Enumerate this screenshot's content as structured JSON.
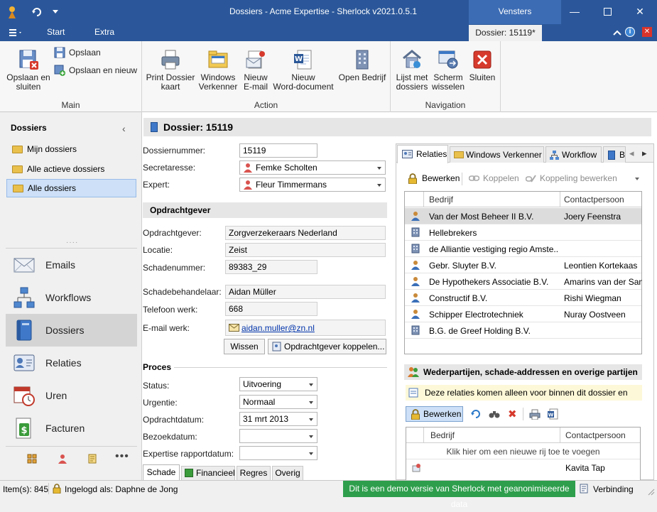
{
  "window": {
    "title": "Dossiers - Acme Expertise - Sherlock v2021.0.5.1",
    "vensters": "Vensters",
    "document_tab": "Dossier: 15119*",
    "menu_tabs": [
      "Start",
      "Extra"
    ]
  },
  "ribbon": {
    "groups": {
      "main": "Main",
      "action": "Action",
      "navigation": "Navigation"
    },
    "save_close": "Opslaan en\nsluiten",
    "save": "Opslaan",
    "save_new": "Opslaan en nieuw",
    "print": "Print Dossier\nkaart",
    "explorer": "Windows\nVerkenner",
    "new_email": "Nieuw\nE-mail",
    "new_word": "Nieuw\nWord-document",
    "open_company": "Open Bedrijf",
    "list_dossiers": "Lijst met\ndossiers",
    "switch_screen": "Scherm\nwisselen",
    "close": "Sluiten"
  },
  "left": {
    "header": "Dossiers",
    "folders": [
      "Mijn dossiers",
      "Alle actieve dossiers",
      "Alle dossiers"
    ],
    "nav": [
      "Emails",
      "Workflows",
      "Dossiers",
      "Relaties",
      "Uren",
      "Facturen"
    ]
  },
  "dossier": {
    "header": "Dossier: 15119",
    "labels": {
      "nummer": "Dossiernummer:",
      "secretaresse": "Secretaresse:",
      "expert": "Expert:",
      "opdrachtgever": "Opdrachtgever:",
      "locatie": "Locatie:",
      "schadenummer": "Schadenummer:",
      "behandelaar": "Schadebehandelaar:",
      "telefoon": "Telefoon werk:",
      "email": "E-mail werk:",
      "status": "Status:",
      "urgentie": "Urgentie:",
      "opdrachtdatum": "Opdrachtdatum:",
      "bezoekdatum": "Bezoekdatum:",
      "rapportdatum": "Expertise rapportdatum:"
    },
    "values": {
      "nummer": "15119",
      "secretaresse": "Femke Scholten",
      "expert": "Fleur Timmermans",
      "opdrachtgever": "Zorgverzekeraars Nederland",
      "locatie": "Zeist",
      "schadenummer": "89383_29",
      "behandelaar": "Aidan Müller",
      "telefoon": "668",
      "email": "aidan.muller@zn.nl",
      "status": "Uitvoering",
      "urgentie": "Normaal",
      "opdrachtdatum": "31 mrt 2013",
      "bezoekdatum": "",
      "rapportdatum": ""
    },
    "section_opdrachtgever": "Opdrachtgever",
    "section_proces": "Proces",
    "btn_wissen": "Wissen",
    "btn_koppelen": "Opdrachtgever koppelen...",
    "bottom_tabs": [
      "Schade",
      "Financieel",
      "Regres",
      "Overig"
    ]
  },
  "right": {
    "tabs": [
      "Relaties",
      "Windows Verkenner",
      "Workflow",
      "B"
    ],
    "toolbar": {
      "edit": "Bewerken",
      "link": "Koppelen",
      "edit_link": "Koppeling bewerken"
    },
    "columns": [
      "Bedrijf",
      "Contactpersoon"
    ],
    "rows": [
      {
        "company": "Van der Most Beheer II B.V.",
        "contact": "Joery Feenstra",
        "icon": "person"
      },
      {
        "company": "Hellebrekers",
        "contact": "",
        "icon": "building"
      },
      {
        "company": "de Alliantie vestiging regio Amste...",
        "contact": "",
        "icon": "building"
      },
      {
        "company": "Gebr. Sluyter B.V.",
        "contact": "Leontien Kortekaas",
        "icon": "person"
      },
      {
        "company": "De Hypothekers Associatie B.V.",
        "contact": "Amarins van der Sanc",
        "icon": "person"
      },
      {
        "company": "Constructif B.V.",
        "contact": "Rishi Wiegman",
        "icon": "person"
      },
      {
        "company": "Schipper Electrotechniek",
        "contact": "Nuray Oostveen",
        "icon": "person"
      },
      {
        "company": "B.G. de Greef Holding B.V.",
        "contact": "",
        "icon": "building"
      }
    ],
    "parties_header": "Wederpartijen, schade-addressen en overige partijen",
    "info": "Deze relaties komen alleen voor binnen dit dossier en",
    "edit2": "Bewerken",
    "columns2": [
      "Bedrijf",
      "Contactpersoon"
    ],
    "new_row_hint": "Klik hier om een nieuwe rij toe te voegen",
    "row2_contact": "Kavita Tap"
  },
  "status": {
    "items": "Item(s): 845",
    "logged_in": "Ingelogd als: Daphne de Jong",
    "demo": "Dit is een demo versie van Sherlock met geanonimiseerde data",
    "connection": "Verbinding"
  },
  "colors": {
    "titlebar": "#2b579a",
    "demo_green": "#2e9e4c",
    "selection": "#cde0f7"
  }
}
